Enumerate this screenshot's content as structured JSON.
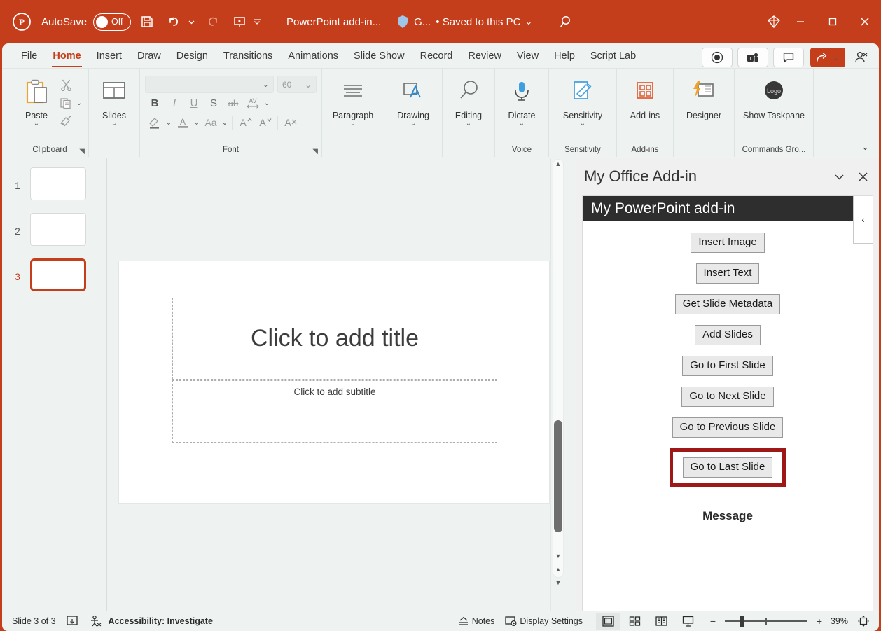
{
  "titlebar": {
    "app_logo": "powerpoint-logo",
    "autosave_label": "AutoSave",
    "autosave_state": "Off",
    "save_icon": "save-icon",
    "undo_icon": "undo-icon",
    "redo_icon": "redo-icon",
    "present_icon": "start-presentation-icon",
    "qat_more_icon": "quick-access-more-icon",
    "document_title": "PowerPoint add-in...",
    "sensitivity_badge": "G...",
    "save_state": "• Saved to this PC",
    "search_icon": "search-icon",
    "diamond_icon": "copilot-diamond-icon",
    "minimize": "minimize-icon",
    "maximize": "maximize-icon",
    "close": "close-icon"
  },
  "ribbon": {
    "tabs": [
      {
        "label": "File",
        "active": false
      },
      {
        "label": "Home",
        "active": true
      },
      {
        "label": "Insert",
        "active": false
      },
      {
        "label": "Draw",
        "active": false
      },
      {
        "label": "Design",
        "active": false
      },
      {
        "label": "Transitions",
        "active": false
      },
      {
        "label": "Animations",
        "active": false
      },
      {
        "label": "Slide Show",
        "active": false
      },
      {
        "label": "Record",
        "active": false
      },
      {
        "label": "Review",
        "active": false
      },
      {
        "label": "View",
        "active": false
      },
      {
        "label": "Help",
        "active": false
      },
      {
        "label": "Script Lab",
        "active": false
      }
    ],
    "right_buttons": [
      {
        "name": "record-button",
        "icon": "record-circle-icon"
      },
      {
        "name": "teams-present-button",
        "icon": "teams-icon"
      },
      {
        "name": "comments-button",
        "icon": "comment-icon"
      },
      {
        "name": "share-button",
        "icon": "share-icon"
      },
      {
        "name": "person-button",
        "icon": "person-add-icon"
      }
    ],
    "collapse_ribbon_icon": "chevron-down-icon",
    "groups": [
      {
        "name": "clipboard",
        "label": "Clipboard",
        "paste_label": "Paste",
        "items": [
          "cut-icon",
          "copy-icon",
          "format-painter-icon"
        ],
        "dialog_launcher": true
      },
      {
        "name": "slides",
        "label": "",
        "slides_label": "Slides"
      },
      {
        "name": "font",
        "label": "Font",
        "font_name_value": "",
        "font_size_value": "60",
        "buttons": [
          "B",
          "I",
          "U",
          "S",
          "ab",
          "AV"
        ],
        "row3": [
          "text-highlight-icon",
          "font-color-icon",
          "Aa",
          "increase-font-size",
          "decrease-font-size",
          "clear-formatting"
        ],
        "dialog_launcher": true
      },
      {
        "name": "paragraph",
        "label": "",
        "button_label": "Paragraph"
      },
      {
        "name": "drawing",
        "label": "",
        "button_label": "Drawing"
      },
      {
        "name": "editing",
        "label": "",
        "button_label": "Editing"
      },
      {
        "name": "voice",
        "label": "Voice",
        "button_label": "Dictate"
      },
      {
        "name": "sensitivity",
        "label": "Sensitivity",
        "button_label": "Sensitivity"
      },
      {
        "name": "addins",
        "label": "Add-ins",
        "button_label": "Add-ins"
      },
      {
        "name": "designer",
        "label": "",
        "button_label": "Designer"
      },
      {
        "name": "commands-group",
        "label": "Commands Gro...",
        "button_label": "Show Taskpane",
        "button_icon_text": "Logo"
      }
    ]
  },
  "thumbnails": [
    {
      "number": "1",
      "selected": false
    },
    {
      "number": "2",
      "selected": false
    },
    {
      "number": "3",
      "selected": true
    }
  ],
  "slide": {
    "title_placeholder": "Click to add title",
    "subtitle_placeholder": "Click to add subtitle"
  },
  "taskpane": {
    "title": "My Office Add-in",
    "collapse_icon": "chevron-down-icon",
    "close_icon": "close-icon",
    "addin_header": "My PowerPoint add-in",
    "side_collapse_icon": "chevron-left-icon",
    "buttons": [
      {
        "label": "Insert Image",
        "highlighted": false
      },
      {
        "label": "Insert Text",
        "highlighted": false
      },
      {
        "label": "Get Slide Metadata",
        "highlighted": false
      },
      {
        "label": "Add Slides",
        "highlighted": false
      },
      {
        "label": "Go to First Slide",
        "highlighted": false
      },
      {
        "label": "Go to Next Slide",
        "highlighted": false
      },
      {
        "label": "Go to Previous Slide",
        "highlighted": false
      },
      {
        "label": "Go to Last Slide",
        "highlighted": true
      }
    ],
    "message_label": "Message",
    "highlight_color": "#9f1818"
  },
  "statusbar": {
    "slide_counter": "Slide 3 of 3",
    "notes_page_icon": "notes-page-icon",
    "accessibility_icon": "accessibility-icon",
    "accessibility_text": "Accessibility: Investigate",
    "notes_label": "Notes",
    "display_settings_label": "Display Settings",
    "views": [
      {
        "name": "normal-view",
        "icon": "normal-view-icon",
        "active": true
      },
      {
        "name": "slide-sorter-view",
        "icon": "slide-sorter-icon",
        "active": false
      },
      {
        "name": "reading-view",
        "icon": "reading-view-icon",
        "active": false
      },
      {
        "name": "slide-show-view",
        "icon": "slide-show-icon",
        "active": false
      }
    ],
    "zoom_out": "−",
    "zoom_in": "+",
    "zoom_percent": "39%",
    "fit_slide_icon": "fit-to-window-icon"
  },
  "colors": {
    "brand": "#c43e1c",
    "ribbon_bg": "#eef3f1",
    "addin_header_bg": "#2e2e2e",
    "highlight": "#9f1818"
  }
}
